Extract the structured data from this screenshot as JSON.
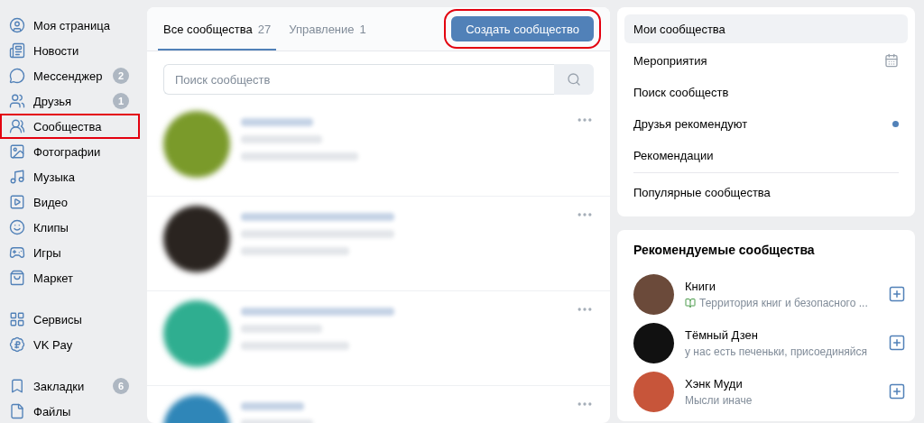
{
  "sidebar": {
    "groups": [
      [
        {
          "label": "Моя страница",
          "highlighted": false
        },
        {
          "label": "Новости",
          "highlighted": false
        },
        {
          "label": "Мессенджер",
          "badge": "2",
          "highlighted": false
        },
        {
          "label": "Друзья",
          "badge": "1",
          "highlighted": false
        },
        {
          "label": "Сообщества",
          "highlighted": true
        },
        {
          "label": "Фотографии",
          "highlighted": false
        },
        {
          "label": "Музыка",
          "highlighted": false
        },
        {
          "label": "Видео",
          "highlighted": false
        },
        {
          "label": "Клипы",
          "highlighted": false
        },
        {
          "label": "Игры",
          "highlighted": false
        },
        {
          "label": "Маркет",
          "highlighted": false
        }
      ],
      [
        {
          "label": "Сервисы",
          "highlighted": false
        },
        {
          "label": "VK Pay",
          "highlighted": false
        }
      ],
      [
        {
          "label": "Закладки",
          "badge": "6",
          "highlighted": false
        },
        {
          "label": "Файлы",
          "highlighted": false
        }
      ]
    ]
  },
  "tabs": [
    {
      "label": "Все сообщества",
      "count": "27",
      "selected": true
    },
    {
      "label": "Управление",
      "count": "1",
      "selected": false
    }
  ],
  "create_button": {
    "label": "Создать сообщество",
    "highlighted": true
  },
  "search": {
    "placeholder": "Поиск сообществ"
  },
  "communities": [
    {
      "color": "#7a9a2a"
    },
    {
      "color": "#2a2420"
    },
    {
      "color": "#2fae90"
    },
    {
      "color": "#2f86b8"
    }
  ],
  "menu": [
    {
      "label": "Мои сообщества",
      "selected": true
    },
    {
      "label": "Мероприятия",
      "selected": false,
      "kind": "calendar"
    },
    {
      "label": "Поиск сообществ",
      "selected": false
    },
    {
      "label": "Друзья рекомендуют",
      "selected": false,
      "kind": "dot"
    },
    {
      "label": "Рекомендации",
      "selected": false
    },
    {
      "label": "Популярные сообщества",
      "selected": false,
      "kind": "separated"
    }
  ],
  "recommended": {
    "title": "Рекомендуемые сообщества",
    "items": [
      {
        "name": "Книги",
        "description": "Территория книг и безопасного ...",
        "book_emoji": true,
        "color": "#6b4a3a"
      },
      {
        "name": "Тёмный Дзен",
        "description": "у нас есть печеньки, присоединяйся",
        "book_emoji": false,
        "color": "#111111"
      },
      {
        "name": "Хэнк Муди",
        "description": "Мысли иначе",
        "book_emoji": false,
        "color": "#c7553a"
      }
    ]
  }
}
